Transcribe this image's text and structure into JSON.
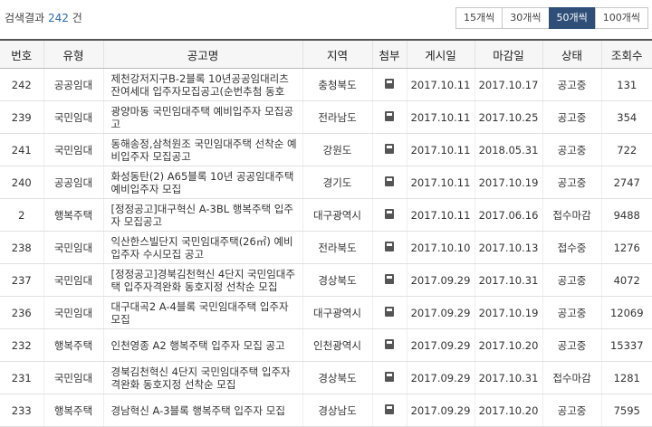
{
  "summary": {
    "label": "검색결과",
    "count": "242",
    "unit": "건"
  },
  "per_page": [
    "15개씩",
    "30개씩",
    "50개씩",
    "100개씩"
  ],
  "columns": [
    "번호",
    "유형",
    "공고명",
    "지역",
    "첨부",
    "게시일",
    "마감일",
    "상태",
    "조회수"
  ],
  "attachment_icon": "file-icon",
  "rows": [
    [
      "242",
      "공공임대",
      "제천강저지구B-2블록 10년공공임대리츠 잔여세대 입주자모집공고(순번추첨 동호",
      "충청북도",
      "2017.10.11",
      "2017.10.17",
      "공고중",
      "131"
    ],
    [
      "239",
      "국민임대",
      "광양마동 국민임대주택 예비입주자 모집공고",
      "전라남도",
      "2017.10.11",
      "2017.10.25",
      "공고중",
      "354"
    ],
    [
      "241",
      "국민임대",
      "동해송정,삼척원조 국민임대주택 선착순 예비입주자 모집공고",
      "강원도",
      "2017.10.11",
      "2018.05.31",
      "공고중",
      "722"
    ],
    [
      "240",
      "공공임대",
      "화성동탄(2) A65블록 10년 공공임대주택 예비입주자 모집",
      "경기도",
      "2017.10.11",
      "2017.10.19",
      "공고중",
      "2747"
    ],
    [
      "2",
      "행복주택",
      "[정정공고]대구혁신 A-3BL 행복주택 입주자 모집공고",
      "대구광역시",
      "2017.10.11",
      "2017.06.16",
      "접수마감",
      "9488"
    ],
    [
      "238",
      "국민임대",
      "익산한스빌단지 국민임대주택(26㎡) 예비입주자 수시모집 공고",
      "전라북도",
      "2017.10.10",
      "2017.10.13",
      "접수중",
      "1276"
    ],
    [
      "237",
      "국민임대",
      "[정정공고]경북김천혁신 4단지 국민임대주택 입주자격완화 동호지정 선착순 모집",
      "경상북도",
      "2017.09.29",
      "2017.10.31",
      "공고중",
      "4072"
    ],
    [
      "236",
      "국민임대",
      "대구대곡2 A-4블록 국민임대주택 입주자 모집",
      "대구광역시",
      "2017.09.29",
      "2017.10.19",
      "공고중",
      "12069"
    ],
    [
      "232",
      "행복주택",
      "인천영종 A2 행복주택 입주자 모집 공고",
      "인천광역시",
      "2017.09.29",
      "2017.10.20",
      "공고중",
      "15337"
    ],
    [
      "231",
      "국민임대",
      "경북김천혁신 4단지 국민임대주택 입주자격완화 동호지정 선착순 모집",
      "경상북도",
      "2017.09.29",
      "2017.10.31",
      "접수마감",
      "1281"
    ],
    [
      "233",
      "행복주택",
      "경남혁신 A-3블록 행복주택 입주자 모집",
      "경상남도",
      "2017.09.29",
      "2017.10.20",
      "공고중",
      "7595"
    ]
  ]
}
